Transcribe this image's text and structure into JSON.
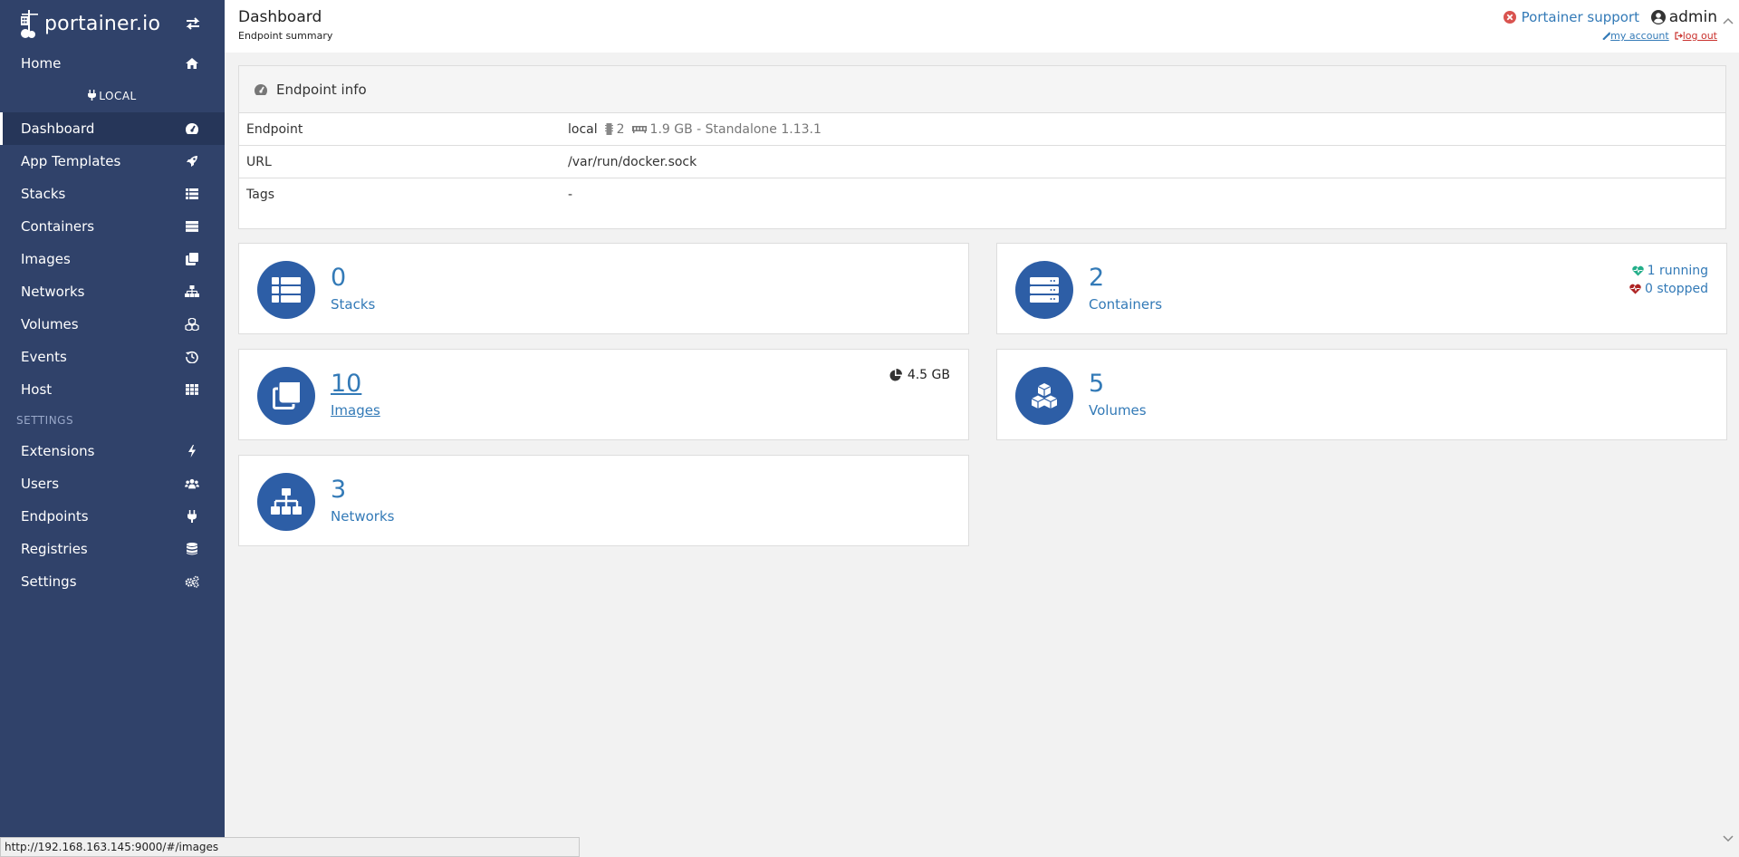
{
  "brand": {
    "name": "portainer.io"
  },
  "sidebar": {
    "home_label": "Home",
    "endpoint_title": "LOCAL",
    "items": [
      {
        "label": "Dashboard",
        "icon": "tachometer-icon"
      },
      {
        "label": "App Templates",
        "icon": "rocket-icon"
      },
      {
        "label": "Stacks",
        "icon": "th-list-icon"
      },
      {
        "label": "Containers",
        "icon": "server-icon"
      },
      {
        "label": "Images",
        "icon": "clone-icon"
      },
      {
        "label": "Networks",
        "icon": "sitemap-icon"
      },
      {
        "label": "Volumes",
        "icon": "cubes-icon"
      },
      {
        "label": "Events",
        "icon": "history-icon"
      },
      {
        "label": "Host",
        "icon": "th-icon"
      }
    ],
    "settings_title": "SETTINGS",
    "settings_items": [
      {
        "label": "Extensions",
        "icon": "bolt-icon"
      },
      {
        "label": "Users",
        "icon": "users-icon"
      },
      {
        "label": "Endpoints",
        "icon": "plug-icon"
      },
      {
        "label": "Registries",
        "icon": "database-icon"
      },
      {
        "label": "Settings",
        "icon": "cogs-icon"
      }
    ]
  },
  "header": {
    "title": "Dashboard",
    "subtitle": "Endpoint summary",
    "support_label": "Portainer support",
    "username": "admin",
    "my_account": "my account",
    "log_out": "log out"
  },
  "endpoint_info": {
    "title": "Endpoint info",
    "rows": [
      {
        "key": "Endpoint",
        "name": "local",
        "cpu": "2",
        "details": "1.9 GB - Standalone 1.13.1"
      },
      {
        "key": "URL",
        "value": "/var/run/docker.sock"
      },
      {
        "key": "Tags",
        "value": "-"
      }
    ]
  },
  "widgets": {
    "stacks": {
      "count": "0",
      "label": "Stacks"
    },
    "containers": {
      "count": "2",
      "label": "Containers",
      "running": "1 running",
      "stopped": "0 stopped"
    },
    "images": {
      "count": "10",
      "label": "Images",
      "size": "4.5 GB"
    },
    "volumes": {
      "count": "5",
      "label": "Volumes"
    },
    "networks": {
      "count": "3",
      "label": "Networks"
    }
  },
  "statusbar": {
    "url": "http://192.168.163.145:9000/#/images"
  },
  "colors": {
    "sidebar": "#30426a",
    "accent": "#337ab7",
    "widget_icon": "#2d5ea6",
    "running": "#23ae89",
    "stopped": "#ae2323"
  }
}
